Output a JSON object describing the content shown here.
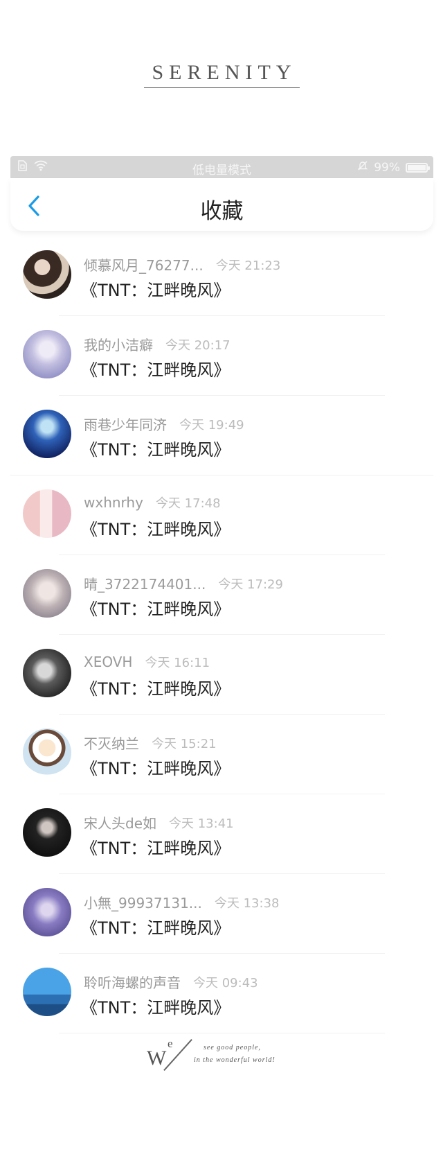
{
  "brand": {
    "text": "SERENITY"
  },
  "status_bar": {
    "center_text": "低电量模式",
    "battery_percent": "99%",
    "icons": [
      "sim-icon",
      "wifi-icon",
      "bell-muted-icon",
      "battery-icon"
    ]
  },
  "nav": {
    "title": "收藏",
    "back_icon": "chevron-left-icon",
    "accent_color": "#1a9be6"
  },
  "items": [
    {
      "name": "倾慕风月_76277...",
      "time": "今天 21:23",
      "title": "《TNT：江畔晚风》"
    },
    {
      "name": "我的小洁癖",
      "time": "今天 20:17",
      "title": "《TNT：江畔晚风》"
    },
    {
      "name": "雨巷少年同济",
      "time": "今天 19:49",
      "title": "《TNT：江畔晚风》"
    },
    {
      "name": "wxhnrhy",
      "time": "今天 17:48",
      "title": "《TNT：江畔晚风》"
    },
    {
      "name": "晴_3722174401...",
      "time": "今天 17:29",
      "title": "《TNT：江畔晚风》"
    },
    {
      "name": "XEOVH",
      "time": "今天 16:11",
      "title": "《TNT：江畔晚风》"
    },
    {
      "name": "不灭纳兰",
      "time": "今天 15:21",
      "title": "《TNT：江畔晚风》"
    },
    {
      "name": "宋人头de如",
      "time": "今天 13:41",
      "title": "《TNT：江畔晚风》"
    },
    {
      "name": "小無_99937131...",
      "time": "今天 13:38",
      "title": "《TNT：江畔晚风》"
    },
    {
      "name": "聆听海螺的声音",
      "time": "今天 09:43",
      "title": "《TNT：江畔晚风》"
    }
  ],
  "footer": {
    "w": "W",
    "e": "e",
    "line1": "see good people,",
    "line2": "in the wonderful world!"
  }
}
